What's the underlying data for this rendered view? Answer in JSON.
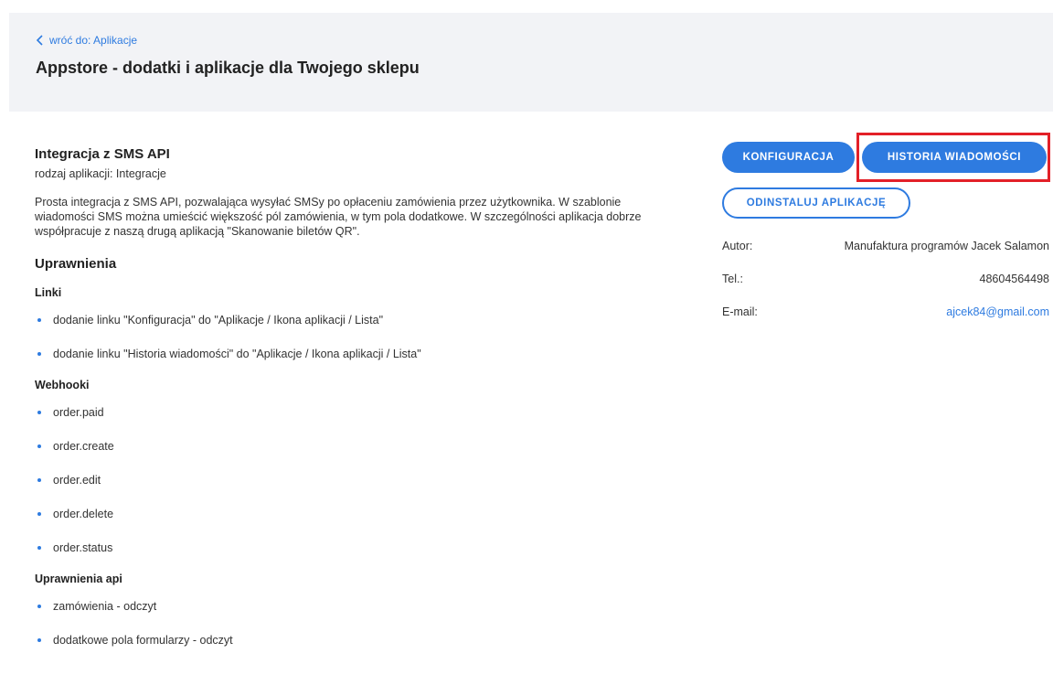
{
  "header": {
    "back_label": "wróć do: Aplikacje",
    "title": "Appstore - dodatki i aplikacje dla Twojego sklepu"
  },
  "app": {
    "name": "Integracja z SMS API",
    "type_label": "rodzaj aplikacji: Integracje",
    "description": "Prosta integracja z SMS API, pozwalająca wysyłać SMSy po opłaceniu zamówienia przez użytkownika. W szablonie wiadomości SMS można umieścić większość pól zamówienia, w tym pola dodatkowe. W szczególności aplikacja dobrze współpracuje z naszą drugą aplikacją \"Skanowanie biletów QR\"."
  },
  "permissions": {
    "title": "Uprawnienia",
    "links": {
      "title": "Linki",
      "items": [
        "dodanie linku \"Konfiguracja\" do \"Aplikacje / Ikona aplikacji / Lista\"",
        "dodanie linku \"Historia wiadomości\" do \"Aplikacje / Ikona aplikacji / Lista\""
      ]
    },
    "webhooks": {
      "title": "Webhooki",
      "items": [
        "order.paid",
        "order.create",
        "order.edit",
        "order.delete",
        "order.status"
      ]
    },
    "api": {
      "title": "Uprawnienia api",
      "items": [
        "zamówienia - odczyt",
        "dodatkowe pola formularzy - odczyt"
      ]
    }
  },
  "actions": {
    "config_label": "KONFIGURACJA",
    "history_label": "HISTORIA WIADOMOŚCI",
    "uninstall_label": "ODINSTALUJ APLIKACJĘ"
  },
  "author_info": {
    "author_label": "Autor:",
    "author_value": "Manufaktura programów Jacek Salamon",
    "tel_label": "Tel.:",
    "tel_value": "48604564498",
    "email_label": "E-mail:",
    "email_value": "ajcek84@gmail.com"
  },
  "colors": {
    "accent": "#2e7be0",
    "highlight": "#e32028",
    "header_bg": "#f2f3f6"
  },
  "icons": {
    "back": "chevron-left-icon"
  }
}
